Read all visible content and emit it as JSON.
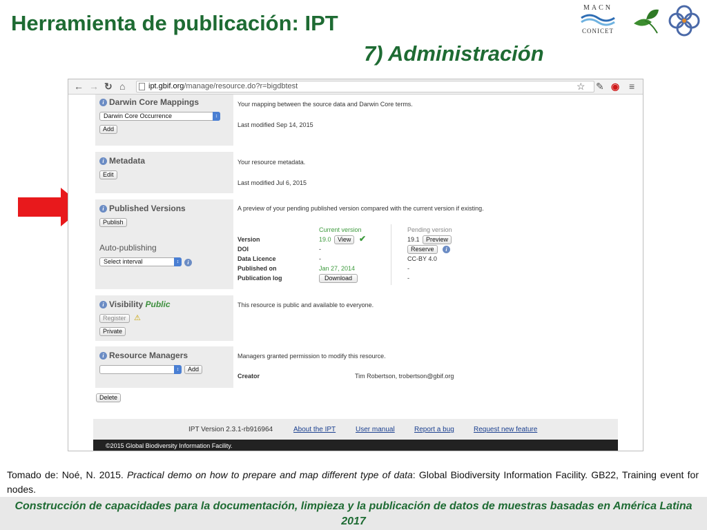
{
  "slide": {
    "title": "Herramienta de publicación: IPT",
    "subtitle": "7) Administración",
    "logo_macn_top": "MACN",
    "logo_macn_bottom": "CONICET",
    "citation_prefix": "Tomado de: Noé, N. 2015. ",
    "citation_italic": "Practical demo on how to prepare and map different type of data",
    "citation_suffix": ": Global Biodiversity Information Facility. GB22, Training event  for nodes.",
    "bottom_banner": "Construcción de capacidades para la documentación, limpieza y la publicación de datos de muestras basadas en América Latina 2017"
  },
  "browser": {
    "url_host": "ipt.gbif.org",
    "url_path": "/manage/resource.do?r=bigdbtest",
    "icons": [
      "back-icon",
      "forward-icon",
      "reload-icon",
      "home-icon",
      "bookmark-star-icon",
      "eyedropper-icon",
      "opera-icon",
      "menu-icon"
    ]
  },
  "ipt": {
    "darwin_core": {
      "title": "Darwin Core Mappings",
      "select_value": "Darwin Core Occurrence",
      "add_label": "Add",
      "description": "Your mapping between the source data and Darwin Core terms.",
      "last_modified": "Last modified Sep 14, 2015"
    },
    "metadata": {
      "title": "Metadata",
      "edit_label": "Edit",
      "description": "Your resource metadata.",
      "last_modified": "Last modified Jul 6, 2015"
    },
    "published_versions": {
      "title": "Published Versions",
      "publish_label": "Publish",
      "auto_publishing_label": "Auto-publishing",
      "interval_select": "Select interval",
      "description": "A preview of your pending published version compared with the current version if existing.",
      "current_header": "Current version",
      "pending_header": "Pending version",
      "rows": [
        {
          "label": "Version",
          "current": "19.0",
          "pending": "19.1"
        },
        {
          "label": "DOI",
          "current": "-",
          "pending": ""
        },
        {
          "label": "Data Licence",
          "current": "-",
          "pending": "CC-BY 4.0"
        },
        {
          "label": "Published on",
          "current": "Jan 27, 2014",
          "pending": "-"
        },
        {
          "label": "Publication log",
          "current": "",
          "pending": "-"
        }
      ],
      "view_label": "View",
      "preview_label": "Preview",
      "reserve_label": "Reserve",
      "download_label": "Download"
    },
    "visibility": {
      "title": "Visibility",
      "status": "Public",
      "register_label": "Register",
      "private_label": "Private",
      "description": "This resource is public and available to everyone."
    },
    "resource_managers": {
      "title": "Resource Managers",
      "add_label": "Add",
      "description": "Managers granted permission to modify this resource.",
      "creator_label": "Creator",
      "creator_value": "Tim Robertson, trobertson@gbif.org"
    },
    "delete_label": "Delete",
    "footer": {
      "version": "IPT Version 2.3.1-rb916964",
      "about": "About the IPT",
      "user_manual": "User manual",
      "report_bug": "Report a bug",
      "request_feature": "Request new feature"
    },
    "copyright": "©2015 Global Biodiversity Information Facility."
  },
  "colors": {
    "title_green": "#1e6b33",
    "arrow_red": "#e8191c",
    "version_green": "#3d9a3d",
    "link_blue": "#1a3f8f"
  }
}
